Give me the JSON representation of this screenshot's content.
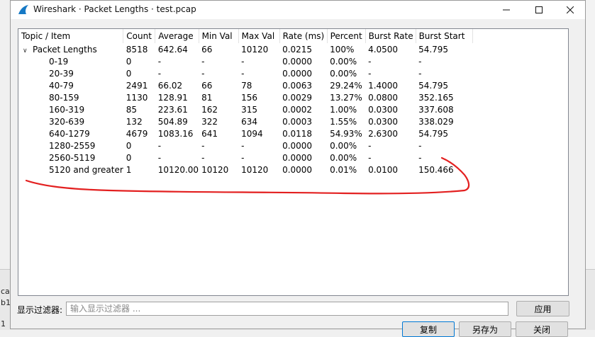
{
  "window": {
    "title": "Wireshark · Packet Lengths · test.pcap"
  },
  "background": {
    "fragments": [
      "ca",
      "b1",
      "1"
    ]
  },
  "table": {
    "columns": [
      "Topic / Item",
      "Count",
      "Average",
      "Min Val",
      "Max Val",
      "Rate (ms)",
      "Percent",
      "Burst Rate",
      "Burst Start"
    ],
    "rows": [
      [
        "Packet Lengths",
        "8518",
        "642.64",
        "66",
        "10120",
        "0.0215",
        "100%",
        "4.0500",
        "54.795"
      ],
      [
        "0-19",
        "0",
        "-",
        "-",
        "-",
        "0.0000",
        "0.00%",
        "-",
        "-"
      ],
      [
        "20-39",
        "0",
        "-",
        "-",
        "-",
        "0.0000",
        "0.00%",
        "-",
        "-"
      ],
      [
        "40-79",
        "2491",
        "66.02",
        "66",
        "78",
        "0.0063",
        "29.24%",
        "1.4000",
        "54.795"
      ],
      [
        "80-159",
        "1130",
        "128.91",
        "81",
        "156",
        "0.0029",
        "13.27%",
        "0.0800",
        "352.165"
      ],
      [
        "160-319",
        "85",
        "223.61",
        "162",
        "315",
        "0.0002",
        "1.00%",
        "0.0300",
        "337.608"
      ],
      [
        "320-639",
        "132",
        "504.89",
        "322",
        "634",
        "0.0003",
        "1.55%",
        "0.0300",
        "338.029"
      ],
      [
        "640-1279",
        "4679",
        "1083.16",
        "641",
        "1094",
        "0.0118",
        "54.93%",
        "2.6300",
        "54.795"
      ],
      [
        "1280-2559",
        "0",
        "-",
        "-",
        "-",
        "0.0000",
        "0.00%",
        "-",
        "-"
      ],
      [
        "2560-5119",
        "0",
        "-",
        "-",
        "-",
        "0.0000",
        "0.00%",
        "-",
        "-"
      ],
      [
        "5120 and greater",
        "1",
        "10120.00",
        "10120",
        "10120",
        "0.0000",
        "0.01%",
        "0.0100",
        "150.466"
      ]
    ]
  },
  "filter": {
    "label": "显示过滤器:",
    "placeholder": "输入显示过滤器 ..."
  },
  "buttons": {
    "apply": "应用",
    "copy": "复制",
    "save_as": "另存为",
    "close": "关闭"
  },
  "annotation": {
    "color": "#e32020"
  }
}
